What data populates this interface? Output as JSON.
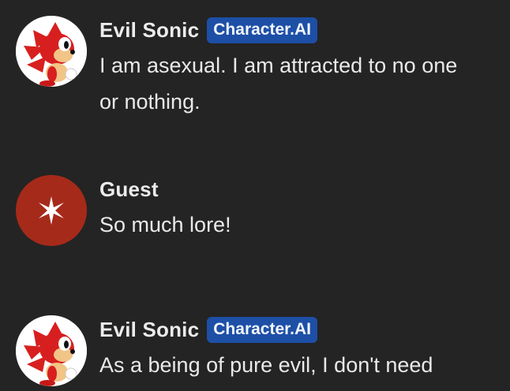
{
  "messages": [
    {
      "author": "Evil Sonic",
      "badge": "Character.AI",
      "avatar_icon": "sonic-character-icon",
      "text": "I am asexual. I am attracted to no one or nothing."
    },
    {
      "author": "Guest",
      "avatar_icon": "star-burst-icon",
      "text": "So much lore!"
    },
    {
      "author": "Evil Sonic",
      "badge": "Character.AI",
      "avatar_icon": "sonic-character-icon",
      "text": "As a being of pure evil, I don't need"
    }
  ],
  "colors": {
    "background": "#242424",
    "badge": "#1d4fa6",
    "guest_avatar": "#a62a1a"
  }
}
